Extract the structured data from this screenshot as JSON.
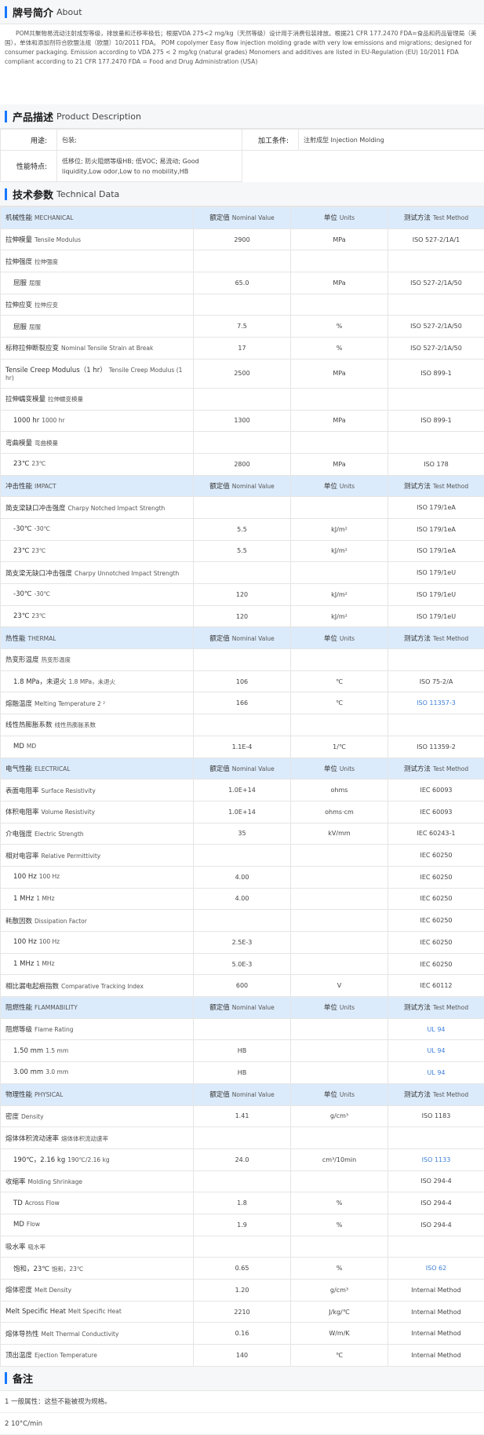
{
  "about": {
    "title_zh": "牌号简介",
    "title_en": "About",
    "text": "POM共聚物易流动注射成型等级，排放量和迁移率极低；根据VDA 275<2 mg/kg（天然等级）设计用于消费包装排放。根据21 CFR 177.2470 FDA=食品和药品管理局（美国），单体和添加剂符合欧盟法规（欧盟）10/2011 FDA。 POM copolymer Easy flow injection molding grade with very low emissions and migrations; designed for consumer packaging. Emission according to VDA 275 < 2 mg/kg (natural grades) Monomers and additives are listed in EU-Regulation (EU) 10/2011 FDA compliant according to 21 CFR 177.2470 FDA = Food and Drug Administration (USA)"
  },
  "description": {
    "title_zh": "产品描述",
    "title_en": "Product Description",
    "use_label": "用途:",
    "use_value": "包装;",
    "processing_label": "加工条件:",
    "processing_value": "注射成型  Injection Molding",
    "features_label": "性能特点:",
    "features_value": "低移位; 防火阻燃等级HB; 低VOC; 易流动;  Good liquidity,Low odor,Low to no mobility,HB"
  },
  "tech": {
    "title_zh": "技术参数",
    "title_en": "Technical Data",
    "rows": [
      {
        "t": "hdr",
        "zh": "机械性能",
        "en": "MECHANICAL",
        "v": "额定值",
        "ven": "Nominal Value",
        "u": "单位",
        "uen": "Units",
        "m": "测试方法",
        "men": "Test Method"
      },
      {
        "t": "row",
        "zh": "拉伸模量",
        "en": "Tensile Modulus",
        "v": "2900",
        "u": "MPa",
        "m": "ISO 527-2/1A/1"
      },
      {
        "t": "row",
        "zh": "拉伸强度",
        "en": "拉伸强度",
        "v": "",
        "u": "",
        "m": ""
      },
      {
        "t": "sub",
        "zh": "屈服",
        "en": "屈服",
        "v": "65.0",
        "u": "MPa",
        "m": "ISO 527-2/1A/50"
      },
      {
        "t": "row",
        "zh": "拉伸应变",
        "en": "拉伸应变",
        "v": "",
        "u": "",
        "m": ""
      },
      {
        "t": "sub",
        "zh": "屈服",
        "en": "屈服",
        "v": "7.5",
        "u": "%",
        "m": "ISO 527-2/1A/50"
      },
      {
        "t": "row",
        "zh": "标称拉伸断裂应变",
        "en": "Nominal Tensile Strain at Break",
        "v": "17",
        "u": "%",
        "m": "ISO 527-2/1A/50"
      },
      {
        "t": "tall",
        "zh": "Tensile Creep Modulus（1 hr）",
        "en": "Tensile Creep Modulus (1 hr)",
        "v": "2500",
        "u": "MPa",
        "m": "ISO 899-1"
      },
      {
        "t": "row",
        "zh": "拉伸蠕变模量",
        "en": "拉伸蠕变模量",
        "v": "",
        "u": "",
        "m": ""
      },
      {
        "t": "sub",
        "zh": "1000 hr",
        "en": "1000 hr",
        "v": "1300",
        "u": "MPa",
        "m": "ISO 899-1"
      },
      {
        "t": "row",
        "zh": "弯曲模量",
        "en": "弯曲模量",
        "v": "",
        "u": "",
        "m": ""
      },
      {
        "t": "sub",
        "zh": "23℃",
        "en": "23℃",
        "v": "2800",
        "u": "MPa",
        "m": "ISO 178"
      },
      {
        "t": "hdr",
        "zh": "冲击性能",
        "en": "IMPACT",
        "v": "额定值",
        "ven": "Nominal Value",
        "u": "单位",
        "uen": "Units",
        "m": "测试方法",
        "men": "Test Method"
      },
      {
        "t": "row",
        "zh": "简支梁缺口冲击强度",
        "en": "Charpy Notched Impact Strength",
        "v": "",
        "u": "",
        "m": "ISO 179/1eA"
      },
      {
        "t": "sub",
        "zh": "-30℃",
        "en": "-30℃",
        "v": "5.5",
        "u": "kJ/m²",
        "m": "ISO 179/1eA"
      },
      {
        "t": "sub",
        "zh": "23℃",
        "en": "23℃",
        "v": "5.5",
        "u": "kJ/m²",
        "m": "ISO 179/1eA"
      },
      {
        "t": "row",
        "zh": "简支梁无缺口冲击强度",
        "en": "Charpy Unnotched Impact Strength",
        "v": "",
        "u": "",
        "m": "ISO 179/1eU"
      },
      {
        "t": "sub",
        "zh": "-30℃",
        "en": "-30℃",
        "v": "120",
        "u": "kJ/m²",
        "m": "ISO 179/1eU"
      },
      {
        "t": "sub",
        "zh": "23℃",
        "en": "23℃",
        "v": "120",
        "u": "kJ/m²",
        "m": "ISO 179/1eU"
      },
      {
        "t": "hdr",
        "zh": "热性能",
        "en": "THERMAL",
        "v": "额定值",
        "ven": "Nominal Value",
        "u": "单位",
        "uen": "Units",
        "m": "测试方法",
        "men": "Test Method"
      },
      {
        "t": "row",
        "zh": "热变形温度",
        "en": "热变形温度",
        "v": "",
        "u": "",
        "m": ""
      },
      {
        "t": "sub",
        "zh": "1.8 MPa，未退火",
        "en": "1.8 MPa，未退火",
        "v": "106",
        "u": "℃",
        "m": "ISO 75-2/A"
      },
      {
        "t": "row",
        "zh": "熔融温度",
        "en": "Melting Temperature  2 ²",
        "v": "166",
        "u": "℃",
        "m": "ISO 11357-3",
        "link": true
      },
      {
        "t": "row",
        "zh": "线性热膨胀系数",
        "en": "线性热膨胀系数",
        "v": "",
        "u": "",
        "m": ""
      },
      {
        "t": "sub",
        "zh": "MD",
        "en": "MD",
        "v": "1.1E-4",
        "u": "1/℃",
        "m": "ISO 11359-2"
      },
      {
        "t": "hdr",
        "zh": "电气性能",
        "en": "ELECTRICAL",
        "v": "额定值",
        "ven": "Nominal Value",
        "u": "单位",
        "uen": "Units",
        "m": "测试方法",
        "men": "Test Method"
      },
      {
        "t": "row",
        "zh": "表面电阻率",
        "en": "Surface Resistivity",
        "v": "1.0E+14",
        "u": "ohms",
        "m": "IEC 60093"
      },
      {
        "t": "row",
        "zh": "体积电阻率",
        "en": "Volume Resistivity",
        "v": "1.0E+14",
        "u": "ohms·cm",
        "m": "IEC 60093"
      },
      {
        "t": "row",
        "zh": "介电强度",
        "en": "Electric Strength",
        "v": "35",
        "u": "kV/mm",
        "m": "IEC 60243-1"
      },
      {
        "t": "row",
        "zh": "相对电容率",
        "en": "Relative Permittivity",
        "v": "",
        "u": "",
        "m": "IEC 60250"
      },
      {
        "t": "sub",
        "zh": "100 Hz",
        "en": "100 Hz",
        "v": "4.00",
        "u": "",
        "m": "IEC 60250"
      },
      {
        "t": "sub",
        "zh": "1 MHz",
        "en": "1 MHz",
        "v": "4.00",
        "u": "",
        "m": "IEC 60250"
      },
      {
        "t": "row",
        "zh": "耗散因数",
        "en": "Dissipation Factor",
        "v": "",
        "u": "",
        "m": "IEC 60250"
      },
      {
        "t": "sub",
        "zh": "100 Hz",
        "en": "100 Hz",
        "v": "2.5E-3",
        "u": "",
        "m": "IEC 60250"
      },
      {
        "t": "sub",
        "zh": "1 MHz",
        "en": "1 MHz",
        "v": "5.0E-3",
        "u": "",
        "m": "IEC 60250"
      },
      {
        "t": "row",
        "zh": "相比漏电起痕指数",
        "en": "Comparative Tracking Index",
        "v": "600",
        "u": "V",
        "m": "IEC 60112"
      },
      {
        "t": "hdr",
        "zh": "阻燃性能",
        "en": "FLAMMABILITY",
        "v": "额定值",
        "ven": "Nominal Value",
        "u": "单位",
        "uen": "Units",
        "m": "测试方法",
        "men": "Test Method"
      },
      {
        "t": "row",
        "zh": "阻燃等级",
        "en": "Flame Rating",
        "v": "",
        "u": "",
        "m": "UL 94",
        "link": true
      },
      {
        "t": "sub",
        "zh": "1.50 mm",
        "en": "1.5 mm",
        "v": "HB",
        "u": "",
        "m": "UL 94",
        "link": true
      },
      {
        "t": "sub",
        "zh": "3.00 mm",
        "en": "3.0 mm",
        "v": "HB",
        "u": "",
        "m": "UL 94",
        "link": true
      },
      {
        "t": "hdr",
        "zh": "物理性能",
        "en": "PHYSICAL",
        "v": "额定值",
        "ven": "Nominal Value",
        "u": "单位",
        "uen": "Units",
        "m": "测试方法",
        "men": "Test Method"
      },
      {
        "t": "row",
        "zh": "密度",
        "en": "Density",
        "v": "1.41",
        "u": "g/cm³",
        "m": "ISO 1183"
      },
      {
        "t": "row",
        "zh": "熔体体积流动速率",
        "en": "熔体体积流动速率",
        "v": "",
        "u": "",
        "m": ""
      },
      {
        "t": "sub",
        "zh": "190℃，2.16 kg",
        "en": "190℃/2.16 kg",
        "v": "24.0",
        "u": "cm³/10min",
        "m": "ISO 1133",
        "link": true
      },
      {
        "t": "row",
        "zh": "收缩率",
        "en": "Molding Shrinkage",
        "v": "",
        "u": "",
        "m": "ISO 294-4"
      },
      {
        "t": "sub",
        "zh": "TD",
        "en": "Across Flow",
        "v": "1.8",
        "u": "%",
        "m": "ISO 294-4"
      },
      {
        "t": "sub",
        "zh": "MD",
        "en": "Flow",
        "v": "1.9",
        "u": "%",
        "m": "ISO 294-4"
      },
      {
        "t": "row",
        "zh": "吸水率",
        "en": "吸水率",
        "v": "",
        "u": "",
        "m": ""
      },
      {
        "t": "sub",
        "zh": "饱和，23℃",
        "en": "饱和，23℃",
        "v": "0.65",
        "u": "%",
        "m": "ISO 62",
        "link": true
      },
      {
        "t": "row",
        "zh": "熔体密度",
        "en": "Melt Density",
        "v": "1.20",
        "u": "g/cm³",
        "m": "Internal Method"
      },
      {
        "t": "row",
        "zh": "Melt Specific Heat",
        "en": "Melt Specific Heat",
        "v": "2210",
        "u": "J/kg/℃",
        "m": "Internal Method"
      },
      {
        "t": "row",
        "zh": "熔体导热性",
        "en": "Melt Thermal Conductivity",
        "v": "0.16",
        "u": "W/m/K",
        "m": "Internal Method"
      },
      {
        "t": "row",
        "zh": "顶出温度",
        "en": "Ejection Temperature",
        "v": "140",
        "u": "℃",
        "m": "Internal Method"
      }
    ]
  },
  "notes": {
    "title_zh": "备注",
    "items": [
      "1 一般属性：这些不能被视为规格。",
      "2 10°C/min"
    ]
  },
  "colors": {
    "accent": "#1677ff",
    "header_row": "#dcebfb",
    "link": "#3d7fd9"
  }
}
